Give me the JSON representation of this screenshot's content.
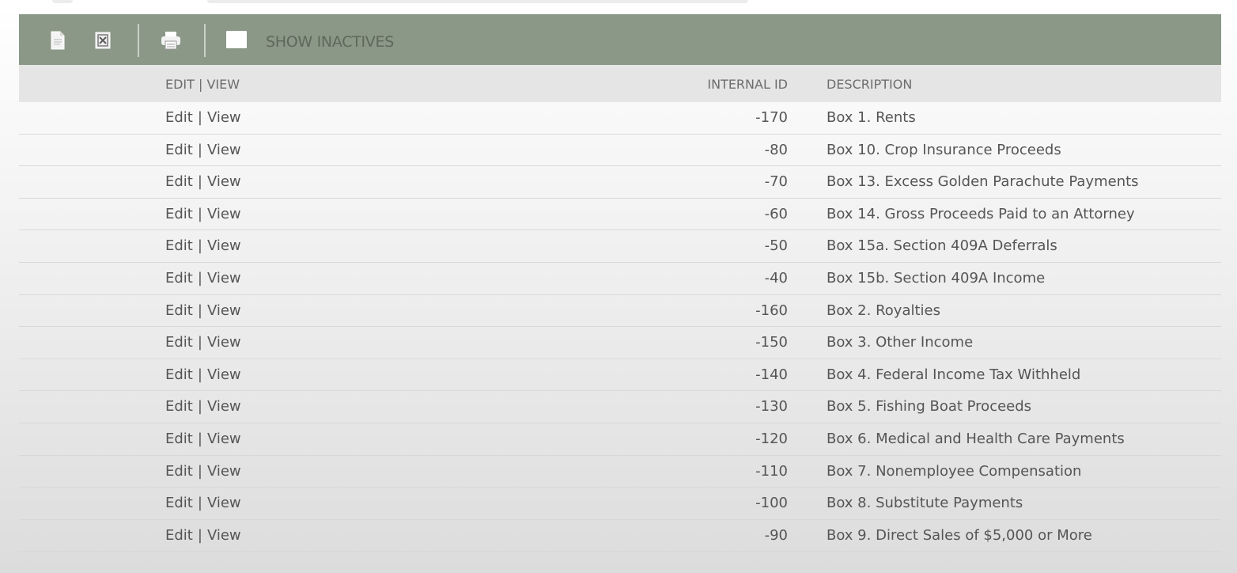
{
  "toolbar": {
    "icons": [
      {
        "name": "new-document-icon"
      },
      {
        "name": "export-icon"
      },
      {
        "name": "print-icon"
      }
    ],
    "show_inactives_label": "SHOW INACTIVES",
    "show_inactives_checked": false,
    "bg_color": "#8b9787"
  },
  "table": {
    "headers": {
      "edit_view": "EDIT | VIEW",
      "internal_id": "INTERNAL ID",
      "description": "DESCRIPTION"
    },
    "rows": [
      {
        "edit": "Edit",
        "view": "View",
        "internal_id": "-170",
        "description": "Box 1. Rents"
      },
      {
        "edit": "Edit",
        "view": "View",
        "internal_id": "-80",
        "description": "Box 10. Crop Insurance Proceeds"
      },
      {
        "edit": "Edit",
        "view": "View",
        "internal_id": "-70",
        "description": "Box 13. Excess Golden Parachute Payments"
      },
      {
        "edit": "Edit",
        "view": "View",
        "internal_id": "-60",
        "description": "Box 14. Gross Proceeds Paid to an Attorney"
      },
      {
        "edit": "Edit",
        "view": "View",
        "internal_id": "-50",
        "description": "Box 15a. Section 409A Deferrals"
      },
      {
        "edit": "Edit",
        "view": "View",
        "internal_id": "-40",
        "description": "Box 15b. Section 409A Income"
      },
      {
        "edit": "Edit",
        "view": "View",
        "internal_id": "-160",
        "description": "Box 2. Royalties"
      },
      {
        "edit": "Edit",
        "view": "View",
        "internal_id": "-150",
        "description": "Box 3. Other Income"
      },
      {
        "edit": "Edit",
        "view": "View",
        "internal_id": "-140",
        "description": "Box 4. Federal Income Tax Withheld"
      },
      {
        "edit": "Edit",
        "view": "View",
        "internal_id": "-130",
        "description": "Box 5. Fishing Boat Proceeds"
      },
      {
        "edit": "Edit",
        "view": "View",
        "internal_id": "-120",
        "description": "Box 6. Medical and Health Care Payments"
      },
      {
        "edit": "Edit",
        "view": "View",
        "internal_id": "-110",
        "description": "Box 7. Nonemployee Compensation"
      },
      {
        "edit": "Edit",
        "view": "View",
        "internal_id": "-100",
        "description": "Box 8. Substitute Payments"
      },
      {
        "edit": "Edit",
        "view": "View",
        "internal_id": "-90",
        "description": "Box 9. Direct Sales of $5,000 or More"
      }
    ]
  }
}
